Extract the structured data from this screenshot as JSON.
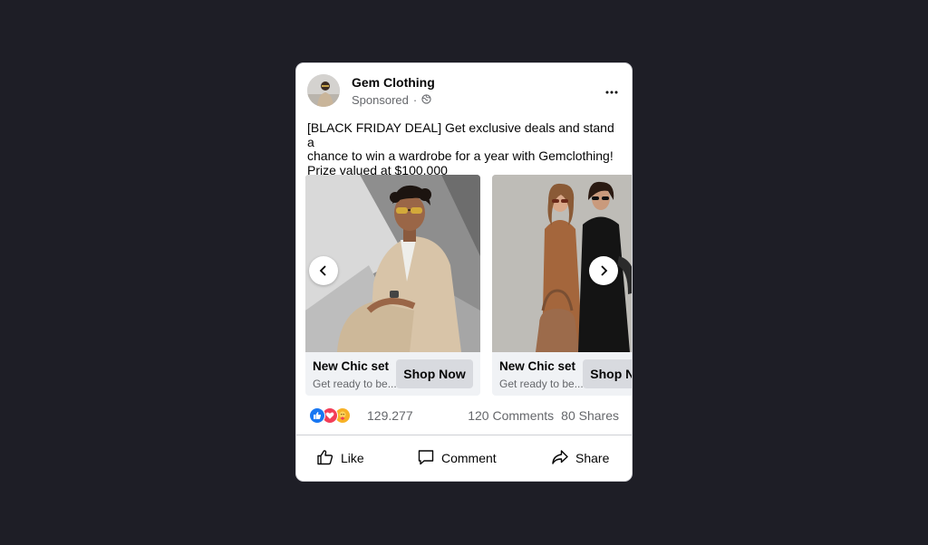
{
  "post": {
    "page_name": "Gem Clothing",
    "sponsored_label": "Sponsored",
    "separator": "·",
    "privacy_icon": "globe-icon",
    "more_icon": "more-options-icon",
    "text_line_1": "[BLACK FRIDAY DEAL] Get exclusive deals and stand a",
    "text_line_2": "chance to win a wardrobe for a year with Gemclothing!",
    "text_line_3": "Prize valued at $100,000"
  },
  "carousel": {
    "items": [
      {
        "title": "New Chic set",
        "description": "Get ready to be...",
        "cta": "Shop Now",
        "image": "model-beige-suit-sunglasses"
      },
      {
        "title": "New Chic set",
        "description": "Get ready to be...",
        "cta": "Shop Now",
        "image": "two-models-coats-handbag"
      }
    ],
    "prev_icon": "chevron-left-icon",
    "next_icon": "chevron-right-icon"
  },
  "stats": {
    "reactions": [
      "like-reaction-icon",
      "love-reaction-icon",
      "care-reaction-icon"
    ],
    "reaction_count": "129.277",
    "comments": "120 Comments",
    "shares": "80 Shares"
  },
  "actions": {
    "like": "Like",
    "comment": "Comment",
    "share": "Share"
  },
  "colors": {
    "background": "#1e1e26",
    "like_blue": "#1877f2",
    "love_red": "#f33e58",
    "care_yellow": "#f7b125",
    "cta_bg": "#d8dadf"
  }
}
